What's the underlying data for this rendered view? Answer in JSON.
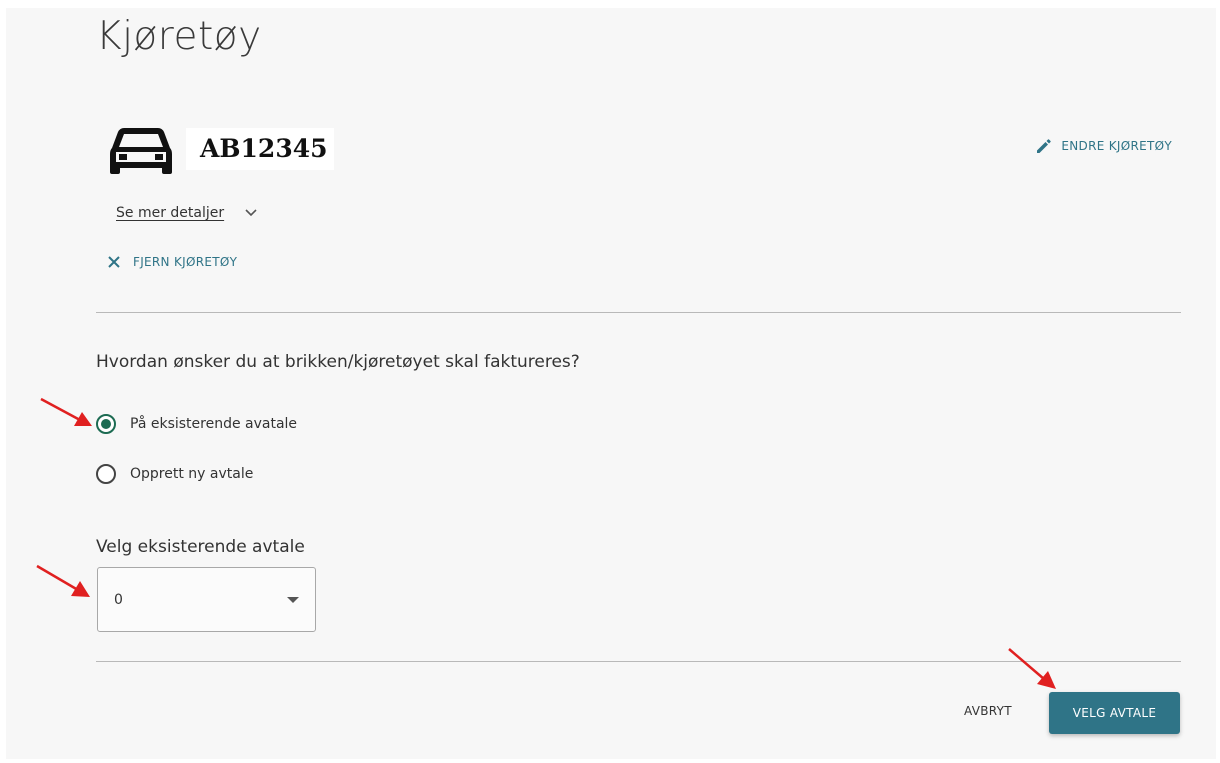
{
  "page": {
    "title": "Kjøretøy"
  },
  "vehicle": {
    "plate": "AB12345",
    "icon": "car-icon",
    "edit_label": "ENDRE KJØRETØY",
    "details_label": "Se mer detaljer",
    "remove_label": "FJERN KJØRETØY"
  },
  "billing": {
    "question": "Hvordan ønsker du at brikken/kjøretøyet skal faktureres?",
    "options": [
      {
        "label": "På eksisterende avatale",
        "checked": true
      },
      {
        "label": "Opprett ny avtale",
        "checked": false
      }
    ],
    "select_label": "Velg eksisterende avtale",
    "select_value": "0"
  },
  "actions": {
    "cancel_label": "AVBRYT",
    "primary_label": "VELG AVTALE"
  },
  "colors": {
    "accent": "#2f7487",
    "radio_checked": "#1c6b52",
    "annotation_arrow": "#e02020"
  }
}
